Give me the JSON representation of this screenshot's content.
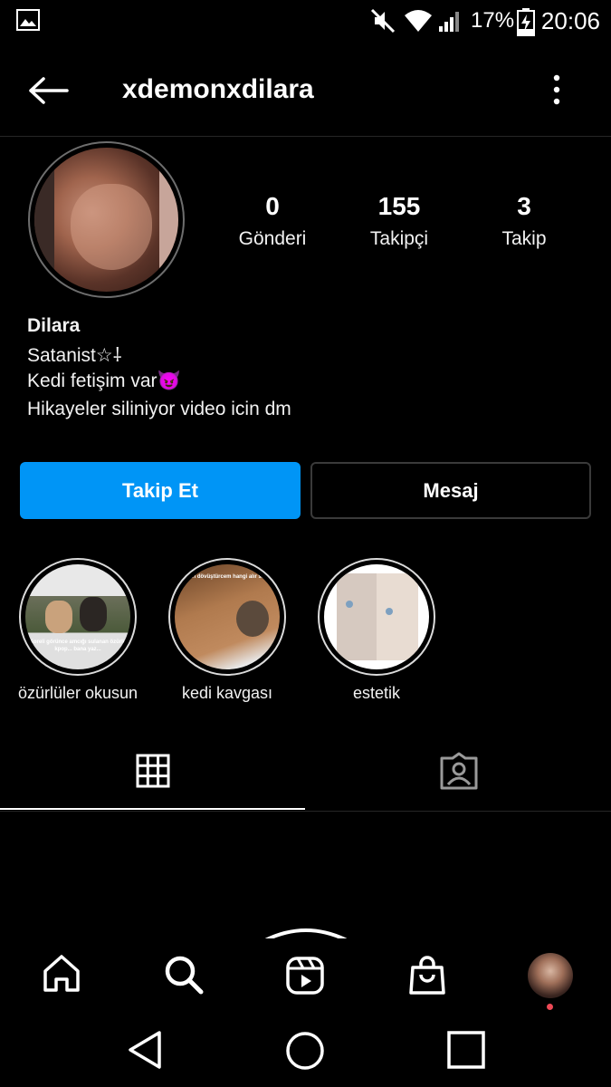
{
  "status_bar": {
    "battery_percent": "17%",
    "time": "20:06"
  },
  "header": {
    "username": "xdemonxdilara"
  },
  "profile": {
    "stats": [
      {
        "value": "0",
        "label": "Gönderi"
      },
      {
        "value": "155",
        "label": "Takipçi"
      },
      {
        "value": "3",
        "label": "Takip"
      }
    ],
    "name": "Dilara",
    "bio_lines": [
      "Satanist☆⸸",
      "Kedi fetişim var😈",
      "Hikayeler siliniyor video icin dm"
    ]
  },
  "actions": {
    "follow_label": "Takip Et",
    "message_label": "Mesaj"
  },
  "highlights": [
    {
      "label": "özürlüler okusun",
      "caption": "Koreli görünce amcığı sulanan özürlü kpop... bana yaz..."
    },
    {
      "label": "kedi kavgası",
      "caption": "dileri dövüştürcem hangi alır sizce"
    },
    {
      "label": "estetik",
      "caption": ""
    }
  ],
  "tabs": [
    "grid-icon",
    "tagged-icon"
  ],
  "bottom_nav": [
    "home-icon",
    "search-icon",
    "reels-icon",
    "shop-icon",
    "profile-avatar"
  ],
  "colors": {
    "accent": "#0095f6",
    "background": "#000000",
    "notification_dot": "#ed4956"
  }
}
